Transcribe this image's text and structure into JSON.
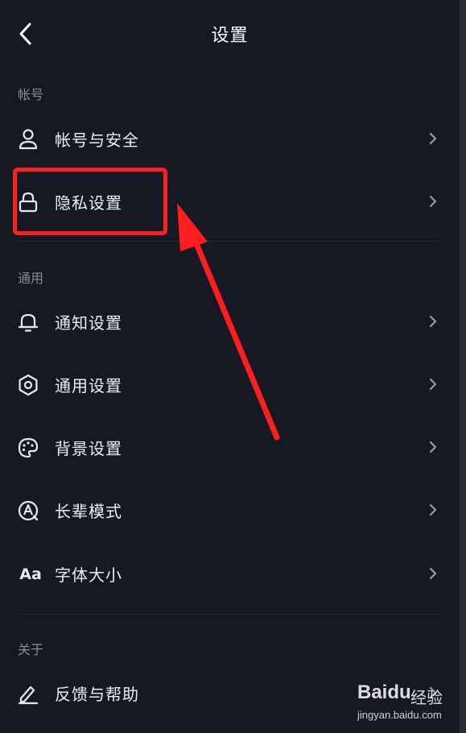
{
  "header": {
    "title": "设置"
  },
  "sections": [
    {
      "label": "帐号",
      "items": [
        {
          "label": "帐号与安全",
          "icon": "user-icon"
        },
        {
          "label": "隐私设置",
          "icon": "lock-icon"
        }
      ]
    },
    {
      "label": "通用",
      "items": [
        {
          "label": "通知设置",
          "icon": "bell-icon"
        },
        {
          "label": "通用设置",
          "icon": "gear-icon"
        },
        {
          "label": "背景设置",
          "icon": "palette-icon"
        },
        {
          "label": "长辈模式",
          "icon": "elder-mode-icon"
        },
        {
          "label": "字体大小",
          "icon": "font-size-icon",
          "icon_text": "Aa"
        }
      ]
    },
    {
      "label": "关于",
      "items": [
        {
          "label": "反馈与帮助",
          "icon": "pencil-icon"
        }
      ]
    }
  ],
  "annotation": {
    "color": "#ff1e1e"
  },
  "watermark": {
    "brand": "Baidu",
    "cn": "经验",
    "url": "jingyan.baidu.com"
  },
  "colors": {
    "background": "#161823",
    "text": "#eeeef2",
    "muted": "#8a8b93",
    "accent": "#ff1e1e"
  }
}
